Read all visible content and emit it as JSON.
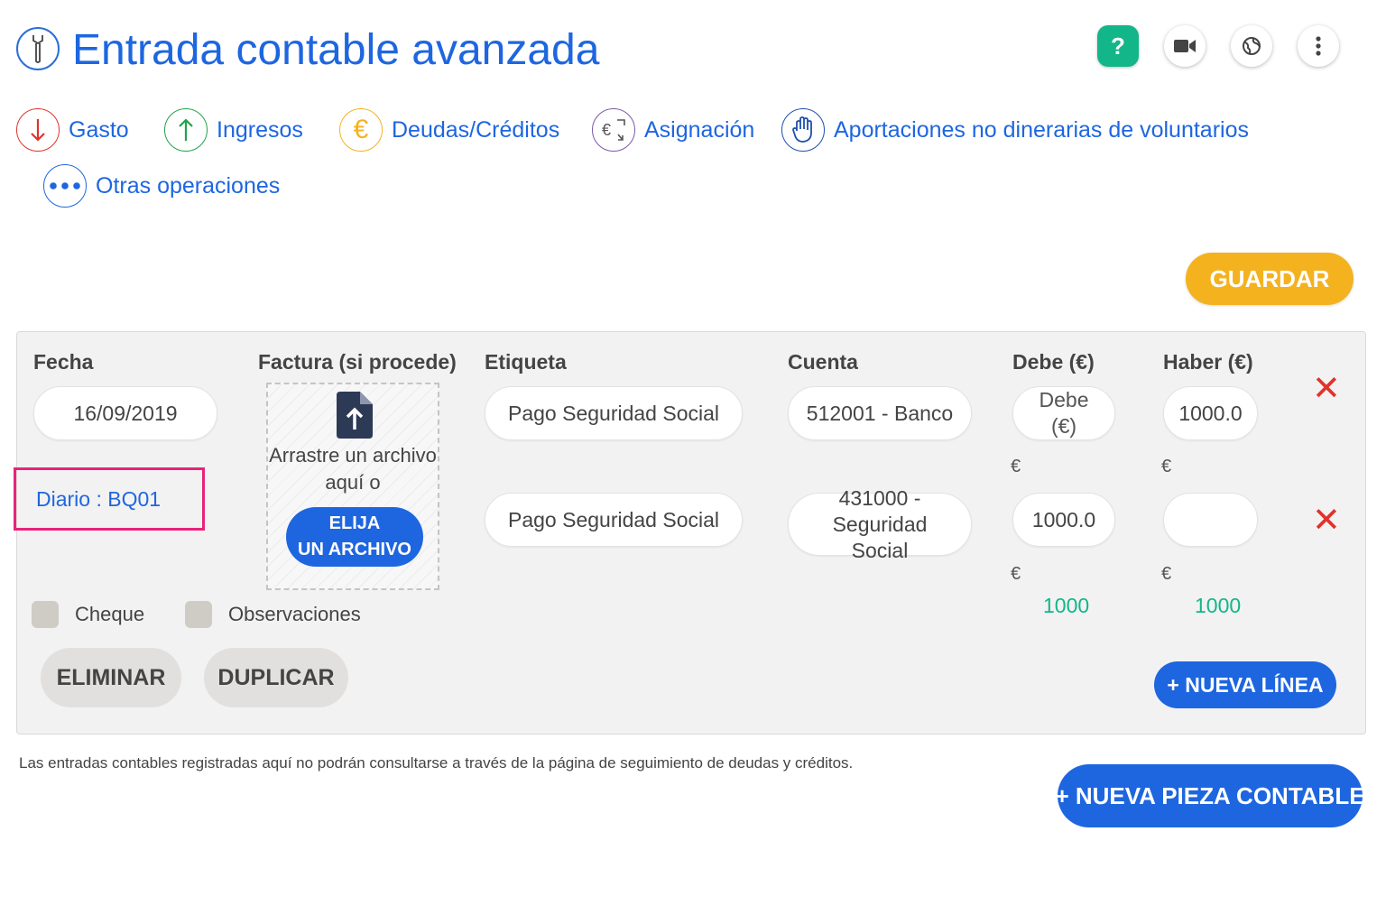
{
  "header": {
    "title": "Entrada contable avanzada",
    "icon": "wrench-icon",
    "actions": [
      {
        "name": "help",
        "label": "?"
      },
      {
        "name": "video",
        "icon": "video-camera-icon"
      },
      {
        "name": "language",
        "icon": "globe-icon"
      },
      {
        "name": "menu",
        "icon": "kebab-menu-icon"
      }
    ]
  },
  "operations": [
    {
      "label": "Gasto",
      "icon": "arrow-down-icon",
      "color": "#e0332b"
    },
    {
      "label": "Ingresos",
      "icon": "arrow-up-icon",
      "color": "#21a34a"
    },
    {
      "label": "Deudas/Créditos",
      "icon": "euro-icon",
      "color": "#f4b21f"
    },
    {
      "label": "Asignación",
      "icon": "euro-exchange-icon",
      "color": "#7a5aa8"
    },
    {
      "label": "Aportaciones no dinerarias de voluntarios",
      "icon": "hand-icon",
      "color": "#1e4fae"
    },
    {
      "label": "Otras operaciones",
      "icon": "more-dots-icon",
      "color": "#1e66e0"
    }
  ],
  "save_label": "GUARDAR",
  "entry": {
    "columns": {
      "date": "Fecha",
      "invoice": "Factura (si procede)",
      "label": "Etiqueta",
      "account": "Cuenta",
      "debit": "Debe (€)",
      "credit": "Haber (€)"
    },
    "date_value": "16/09/2019",
    "journal": "Diario : BQ01",
    "dropzone": {
      "text_line1": "Arrastre un archivo",
      "text_line2": "aquí o",
      "button_line1": "ELIJA",
      "button_line2": "UN ARCHIVO"
    },
    "lines": [
      {
        "label": "Pago Seguridad Social",
        "account_line1": "512001 - Banco",
        "account_line2": "",
        "debit_value": "",
        "debit_placeholder": "Debe (€)",
        "credit_value": "1000.0",
        "credit_placeholder": ""
      },
      {
        "label": "Pago Seguridad Social",
        "account_line1": "431000 - Seguridad",
        "account_line2": "Social",
        "debit_value": "1000.0",
        "debit_placeholder": "",
        "credit_value": "",
        "credit_placeholder": ""
      }
    ],
    "currency_symbol": "€",
    "totals": {
      "debit": "1000",
      "credit": "1000"
    },
    "checkboxes": {
      "cheque": "Cheque",
      "observaciones": "Observaciones"
    },
    "buttons": {
      "delete": "ELIMINAR",
      "duplicate": "DUPLICAR",
      "new_line": "+ NUEVA LÍNEA"
    }
  },
  "footnote": "Las entradas contables registradas aquí no podrán consultarse a través de la página de seguimiento de deudas y créditos.",
  "new_piece_label": "+ NUEVA PIEZA CONTABLE",
  "colors": {
    "primary": "#1e66e0",
    "accent": "#f4b21f",
    "success": "#13b689",
    "danger": "#e0332b",
    "highlight": "#e8237a"
  }
}
